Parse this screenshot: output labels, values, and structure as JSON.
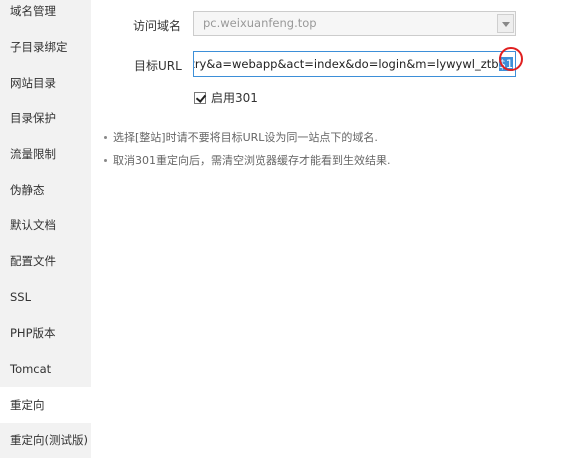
{
  "sidebar": {
    "items": [
      {
        "label": "域名管理"
      },
      {
        "label": "子目录绑定"
      },
      {
        "label": "网站目录"
      },
      {
        "label": "目录保护"
      },
      {
        "label": "流量限制"
      },
      {
        "label": "伪静态"
      },
      {
        "label": "默认文档"
      },
      {
        "label": "配置文件"
      },
      {
        "label": "SSL"
      },
      {
        "label": "PHP版本"
      },
      {
        "label": "Tomcat"
      },
      {
        "label": "重定向"
      },
      {
        "label": "重定向(测试版)"
      }
    ],
    "active_index": 11
  },
  "form": {
    "domain_label": "访问域名",
    "domain_value": "pc.weixuanfeng.top",
    "target_label": "目标URL",
    "target_value": "c=entry&a=webapp&act=index&do=login&m=lywywl_ztb",
    "target_selected": "$1",
    "enable_301_label": "启用301",
    "enable_301_checked": true
  },
  "notes": [
    "选择[整站]时请不要将目标URL设为同一站点下的域名.",
    "取消301重定向后，需清空浏览器缓存才能看到生效结果."
  ],
  "colors": {
    "sidebar_bg": "#f2f2f2",
    "active_bg": "#ffffff",
    "input_border_focus": "#3d8fd8",
    "highlight_circle": "#e02020"
  }
}
